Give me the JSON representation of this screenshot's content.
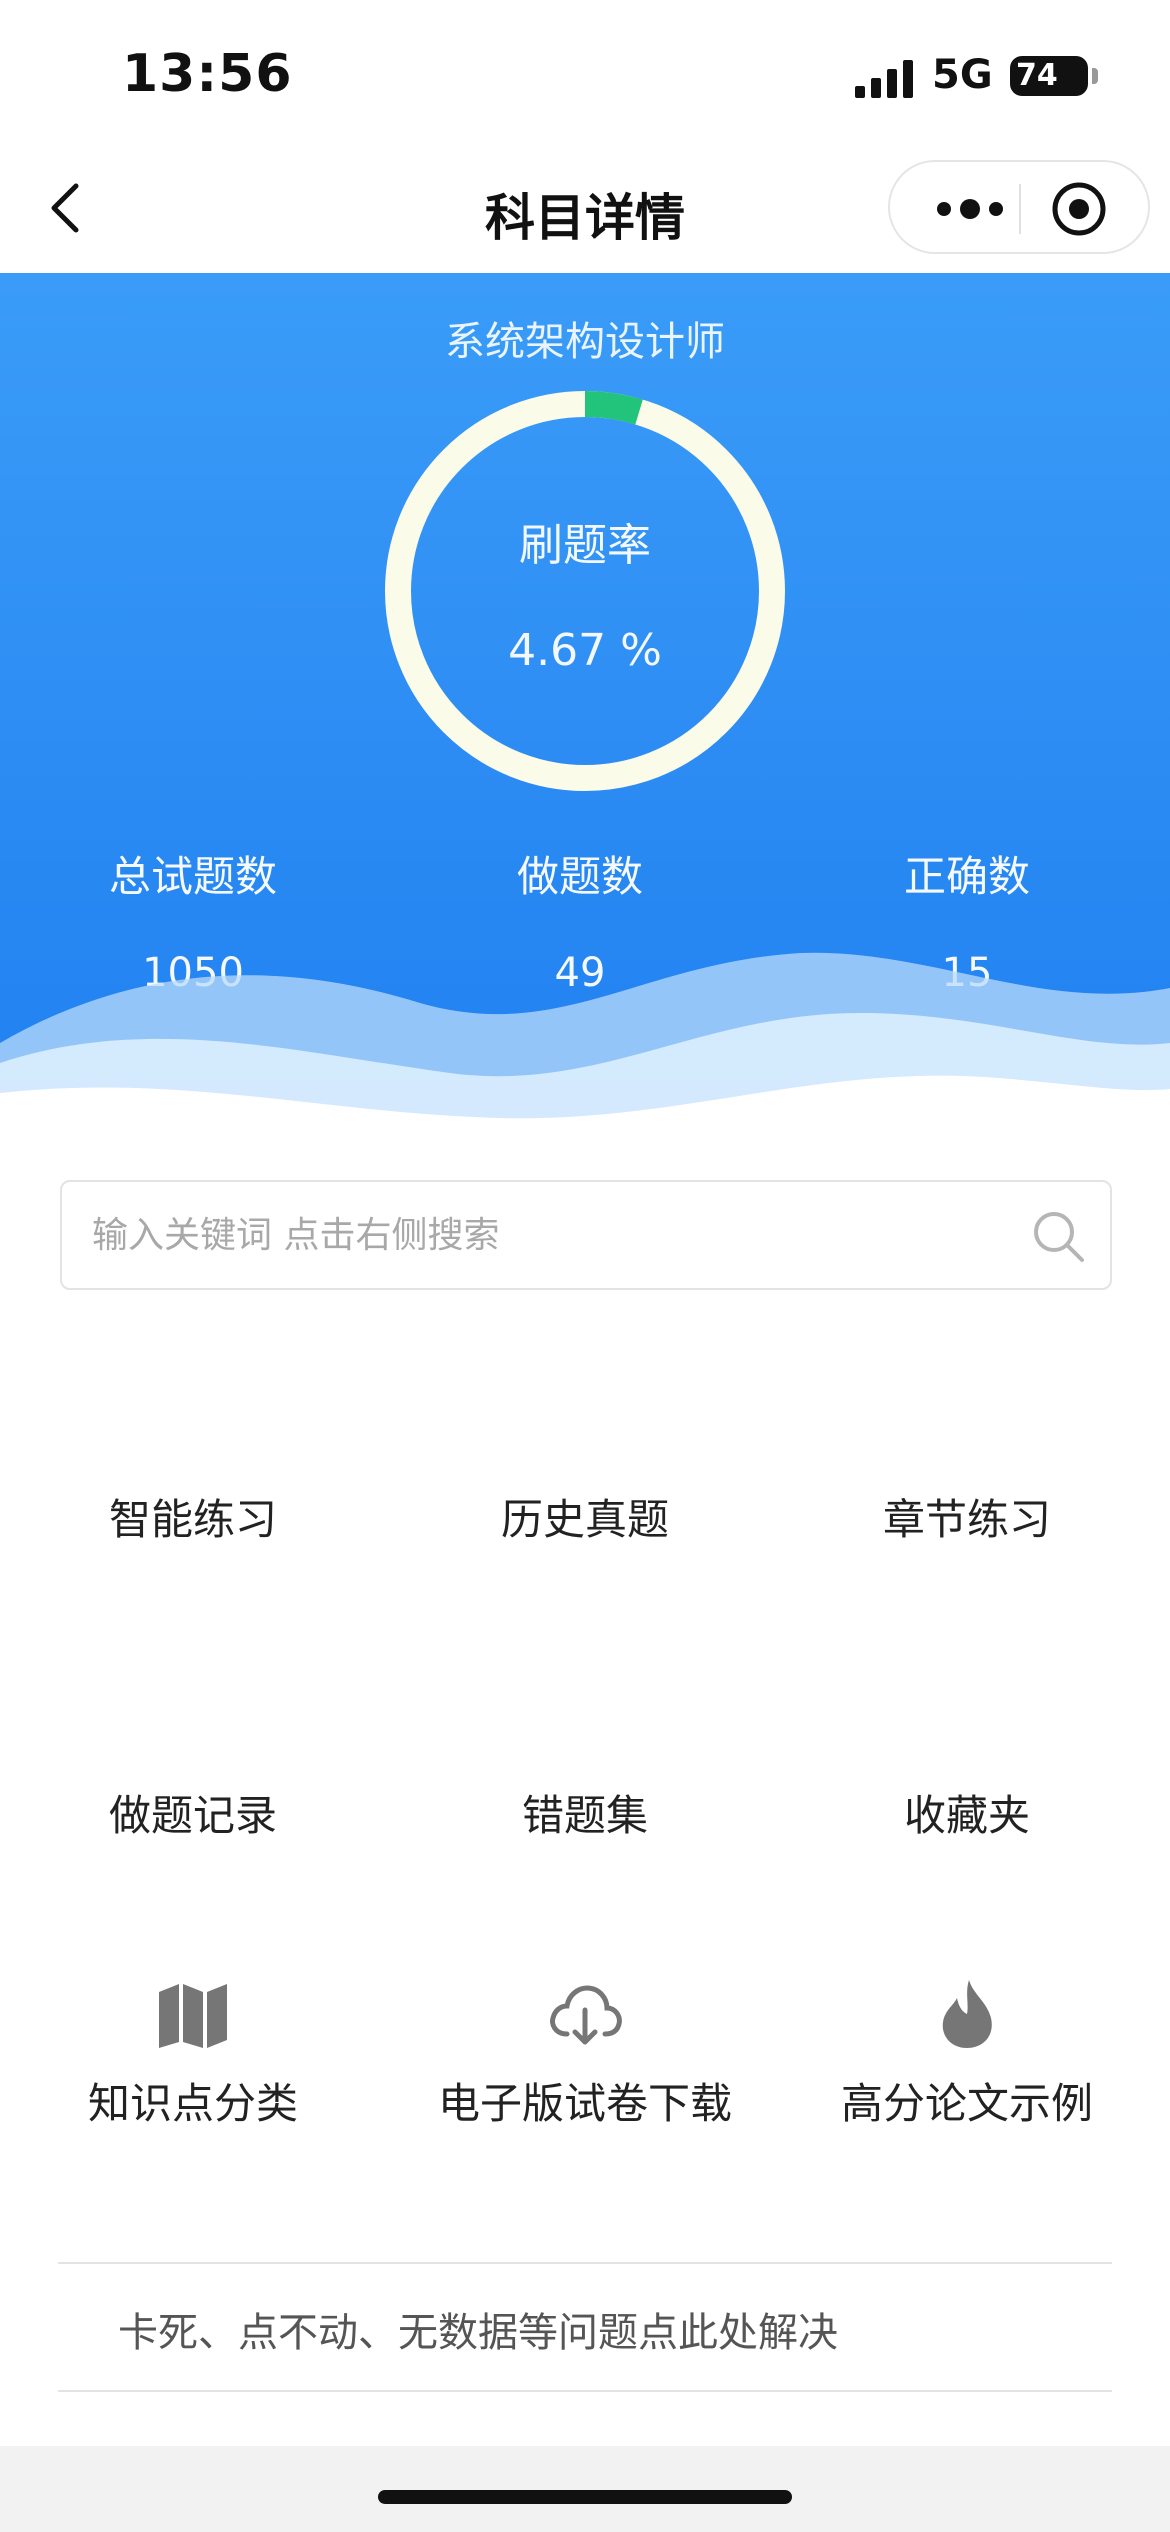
{
  "status_bar": {
    "time": "13:56",
    "network": "5G",
    "battery": "74"
  },
  "nav": {
    "title": "科目详情"
  },
  "hero": {
    "subject": "系统架构设计师",
    "rate_label": "刷题率",
    "rate_value": "4.67 %",
    "rate_fraction": 0.0467,
    "stats": [
      {
        "label": "总试题数",
        "value": "1050"
      },
      {
        "label": "做题数",
        "value": "49"
      },
      {
        "label": "正确数",
        "value": "15"
      }
    ]
  },
  "search": {
    "placeholder": "输入关键词 点击右侧搜索"
  },
  "menu": [
    {
      "label": "智能练习"
    },
    {
      "label": "历史真题"
    },
    {
      "label": "章节练习"
    },
    {
      "label": "做题记录"
    },
    {
      "label": "错题集"
    },
    {
      "label": "收藏夹"
    },
    {
      "label": "知识点分类",
      "icon": "map-icon"
    },
    {
      "label": "电子版试卷下载",
      "icon": "cloud-download-icon"
    },
    {
      "label": "高分论文示例",
      "icon": "flame-icon"
    }
  ],
  "help": {
    "text": "卡死、点不动、无数据等问题点此处解决"
  },
  "colors": {
    "accent": "#2f8ff4",
    "progress": "#22c37a",
    "ring_track": "#fbfbe9"
  }
}
